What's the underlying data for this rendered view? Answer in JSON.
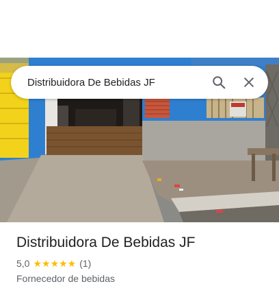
{
  "search": {
    "query": "Distribuidora De Bebidas JF"
  },
  "place": {
    "name": "Distribuidora De Bebidas JF",
    "rating": "5,0",
    "rating_value": 5.0,
    "stars": "★★★★★",
    "review_count": "(1)",
    "category": "Fornecedor de bebidas"
  },
  "icons": {
    "search": "search-icon",
    "close": "close-icon"
  },
  "colors": {
    "star": "#fbbc04",
    "wall_blue": "#2f7fd1",
    "door_yellow": "#f2d21b"
  }
}
